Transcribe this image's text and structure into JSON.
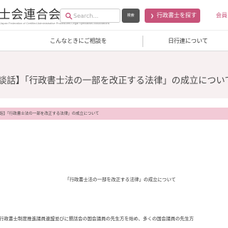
{
  "header": {
    "logo_main": "士会連合会",
    "logo_sub": "Japan Federation of Certified Administrative Procedures Legal Specialists Associations",
    "search": {
      "placeholder": "Search...",
      "value": ""
    },
    "search_button_label": "検索",
    "find_button_label": "行政書士を探す",
    "member_link_label": "会員"
  },
  "nav": {
    "items": [
      {
        "label": "こんなときにご相談を"
      },
      {
        "label": "日行連について"
      }
    ]
  },
  "page_title": "談話】「行政書士法の一部を改正する法律」の成立について",
  "breadcrumb": "話】「行政書士法の一部を改正する法律」の成立について",
  "content": {
    "title": "「行政書士法の一部を改正する法律」の成立について",
    "body": "行政書士制度推進議員連盟並びに懇話会の国会議員の先生方を始め、多くの国会議員の先生方"
  },
  "colors": {
    "accent_pink": "#c8537a",
    "breadcrumb_band": "#f2cad6",
    "title_band": "#f7f0f1",
    "search_button": "#555555"
  }
}
